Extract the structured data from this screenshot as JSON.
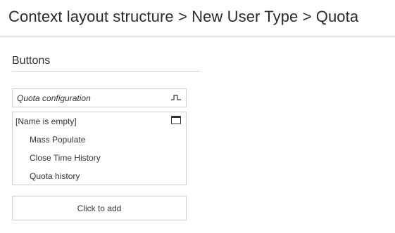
{
  "header": {
    "breadcrumb": "Context layout structure > New User Type > Quota"
  },
  "section": {
    "title": "Buttons"
  },
  "quota_config": {
    "label": "Quota configuration",
    "icon": "collapse-icon"
  },
  "group": {
    "name": "[Name is empty]",
    "icon": "window-icon",
    "items": [
      {
        "label": "Mass Populate"
      },
      {
        "label": "Close Time History"
      },
      {
        "label": "Quota history"
      }
    ]
  },
  "add": {
    "label": "Click to add"
  },
  "colors": {
    "border": "#cfcfcf",
    "text": "#333333",
    "header_rule": "#c9c9c9"
  }
}
